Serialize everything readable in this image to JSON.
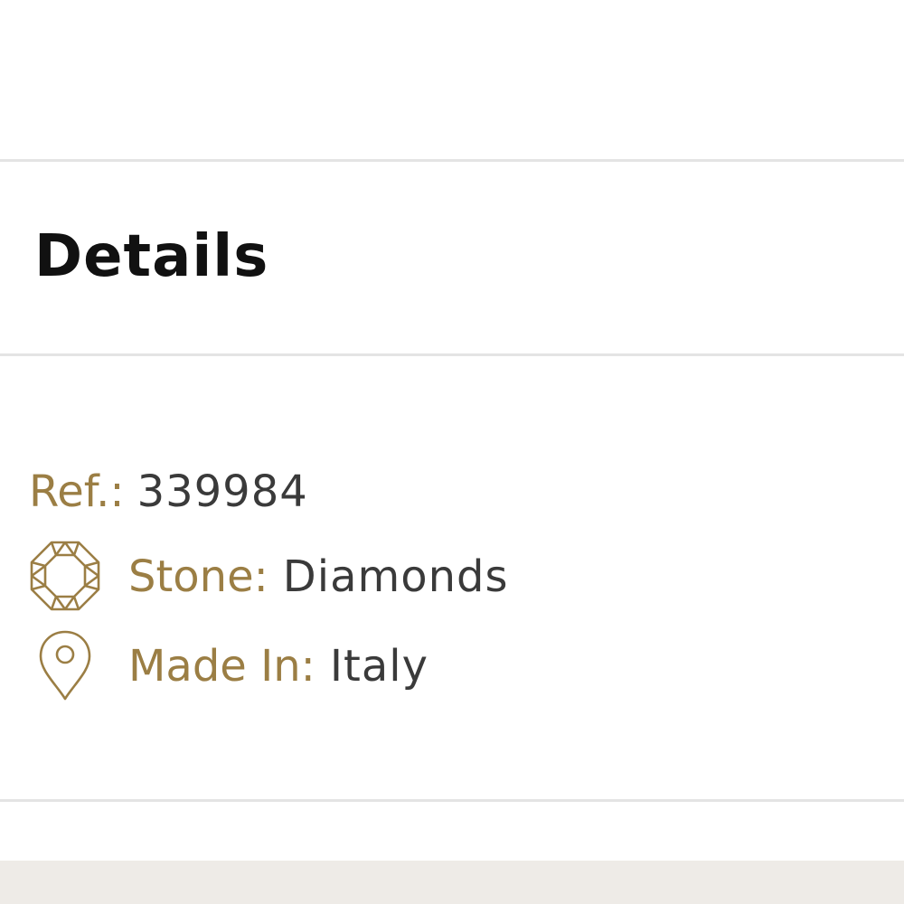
{
  "details": {
    "title": "Details",
    "ref": {
      "label": "Ref.:",
      "value": "339984"
    },
    "stone": {
      "label": "Stone:",
      "value": "Diamonds",
      "icon": "gem-icon"
    },
    "made_in": {
      "label": "Made In:",
      "value": "Italy",
      "icon": "location-pin-icon"
    }
  },
  "colors": {
    "label_accent": "#9b7e44",
    "value_text": "#3a3a3a",
    "title_text": "#111111",
    "divider": "#e4e4e4",
    "footer_band": "#eeebe7"
  }
}
